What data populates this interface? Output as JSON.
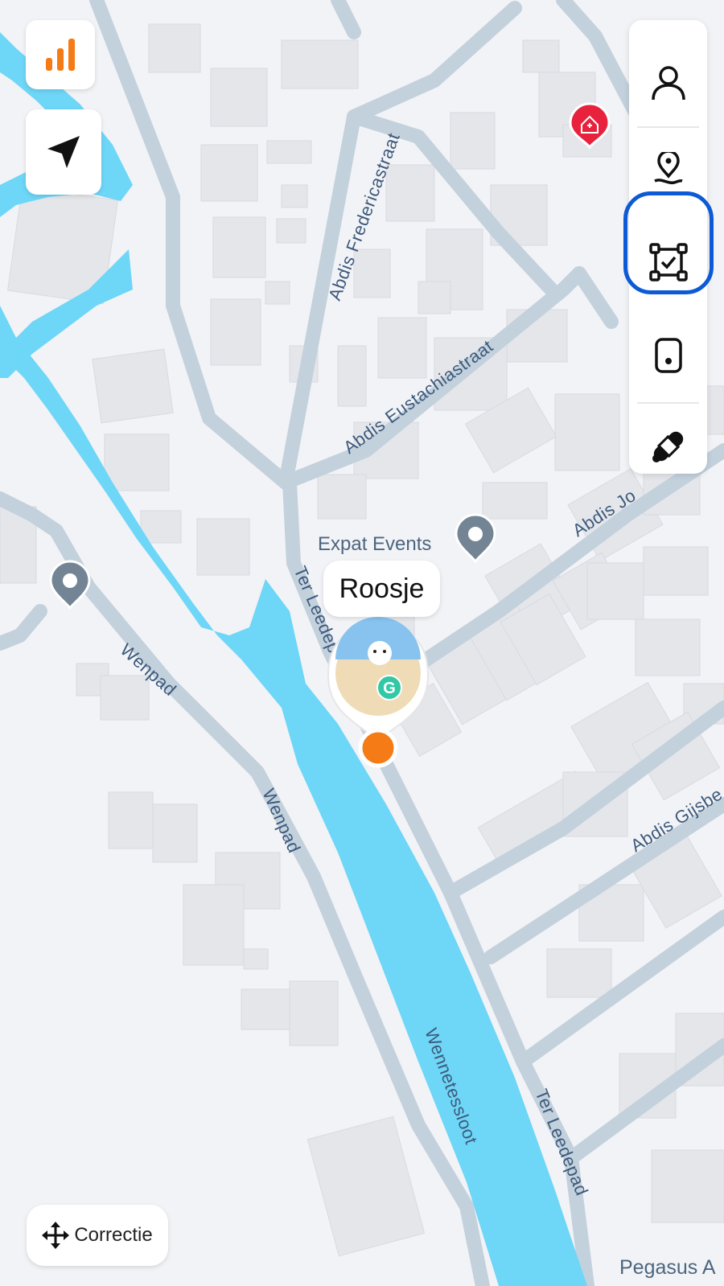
{
  "map": {
    "streets": [
      {
        "id": "abdis-fredericastraat",
        "label": "Abdis Fredericastraat"
      },
      {
        "id": "abdis-eustachiastraat",
        "label": "Abdis Eustachiastraat"
      },
      {
        "id": "abdis-jo",
        "label": "Abdis Jo"
      },
      {
        "id": "ter-leedepad-top",
        "label": "Ter Leedepad"
      },
      {
        "id": "wenpad-1",
        "label": "Wenpad"
      },
      {
        "id": "wenpad-2",
        "label": "Wenpad"
      },
      {
        "id": "abdis-gijsbe",
        "label": "Abdis Gijsbe"
      },
      {
        "id": "wennetessloot",
        "label": "Wennetessloot"
      },
      {
        "id": "ter-leedepad-bottom",
        "label": "Ter Leedepad"
      }
    ],
    "poi": {
      "label": "Expat Events"
    },
    "bottom_label": "Pegasus A",
    "colors": {
      "water": "#6ed6f7",
      "road": "#c4d1dd",
      "building": "#e6e7ea",
      "accent": "#f47b16",
      "selected": "#0d5ad6",
      "hospital": "#e8223c"
    }
  },
  "pet_marker": {
    "name": "Roosje",
    "badge_letter": "G"
  },
  "left_controls": {
    "signal_icon": "signal-bars-icon",
    "locate_icon": "navigation-arrow-icon"
  },
  "right_panel": {
    "items": [
      {
        "icon": "person-icon"
      },
      {
        "icon": "route-pin-icon"
      },
      {
        "icon": "geofence-check-icon",
        "selected": true
      },
      {
        "icon": "device-tracker-icon"
      },
      {
        "icon": "bandage-icon"
      }
    ]
  },
  "correctie_button": {
    "label": "Correctie",
    "icon": "move-arrows-icon"
  }
}
